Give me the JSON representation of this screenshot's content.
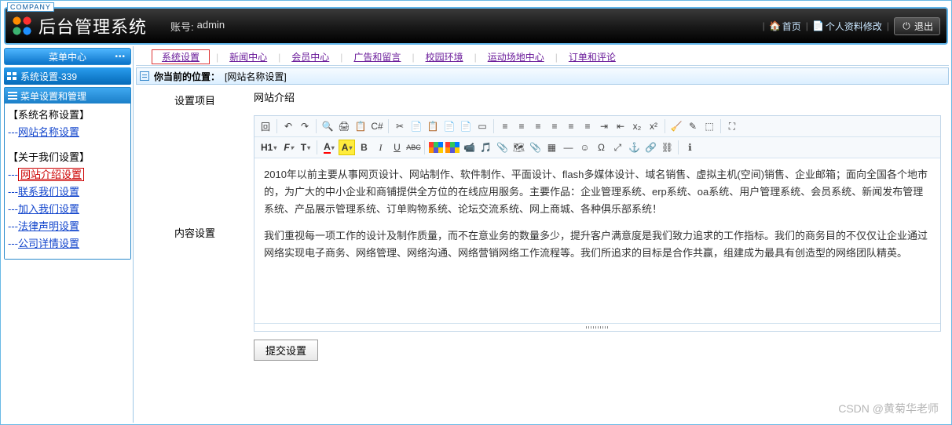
{
  "company_tag": "COMPANY",
  "app_title": "后台管理系统",
  "account": {
    "label": "账号:",
    "value": "admin"
  },
  "header_links": {
    "home": "首页",
    "profile": "个人资料修改",
    "logout": "退出"
  },
  "sidebar": {
    "menu_center": "菜单中心",
    "sys_bar": "系统设置-339",
    "box_title": "菜单设置和管理",
    "group1": "【系统名称设置】",
    "item1": "网站名称设置",
    "group2": "【关于我们设置】",
    "item2": "网站介绍设置",
    "item3": "联系我们设置",
    "item4": "加入我们设置",
    "item5": "法律声明设置",
    "item6": "公司详情设置",
    "dashes": "---"
  },
  "tabs": {
    "t1": "系统设置",
    "t2": "新闻中心",
    "t3": "会员中心",
    "t4": "广告和留言",
    "t5": "校园环境",
    "t6": "运动场地中心",
    "t7": "订单和评论"
  },
  "crumb": {
    "label": "你当前的位置：",
    "value": "[网站名称设置]"
  },
  "form": {
    "label_item": "设置项目",
    "value_item": "网站介绍",
    "label_content": "内容设置",
    "submit": "提交设置",
    "para1": "2010年以前主要从事网页设计、网站制作、软件制作、平面设计、flash多媒体设计、域名销售、虚拟主机(空间)销售、企业邮箱；面向全国各个地市的，为广大的中小企业和商铺提供全方位的在线应用服务。主要作品：企业管理系统、erp系统、oa系统、用户管理系统、会员系统、新闻发布管理系统、产品展示管理系统、订单购物系统、论坛交流系统、网上商城、各种俱乐部系统！",
    "para2": "我们重视每一项工作的设计及制作质量，而不在意业务的数量多少，提升客户满意度是我们致力追求的工作指标。我们的商务目的不仅仅让企业通过网络实现电子商务、网络管理、网络沟通、网络营销网络工作流程等。我们所追求的目标是合作共赢，组建成为最具有创造型的网络团队精英。"
  },
  "toolbar": {
    "h1": "H1",
    "font": "F",
    "tt": "T",
    "a": "A",
    "bold": "B",
    "italic": "I",
    "underline": "U",
    "strike": "ABC",
    "source": "回",
    "undo": "↶",
    "redo": "↷",
    "preview": "🔍",
    "print": "🖨",
    "template": "📋",
    "code": "C#",
    "cut": "✂",
    "copy": "📄",
    "paste": "📋",
    "plaintext": "📄",
    "word": "📄",
    "selectall": "▭",
    "jl": "≡",
    "jc": "≡",
    "jr": "≡",
    "jj": "≡",
    "ol": "≡",
    "ul": "≡",
    "indent": "⇥",
    "outdent": "⇤",
    "sub": "x₂",
    "sup": "x²",
    "removeformat": "🧹",
    "quickformat": "✎",
    "sel": "⬚",
    "fullscreen": "⛶",
    "img": "🖼",
    "flash": "📹",
    "media": "🎵",
    "upload": "📎",
    "map": "🗺",
    "insertfile": "📎",
    "table": "▦",
    "hr": "—",
    "emoji": "☺",
    "special": "Ω",
    "pagebreak": "⤢",
    "anchor": "⚓",
    "link": "🔗",
    "unlink": "⛓",
    "about": "ℹ"
  },
  "watermark": "CSDN @黄菊华老师"
}
